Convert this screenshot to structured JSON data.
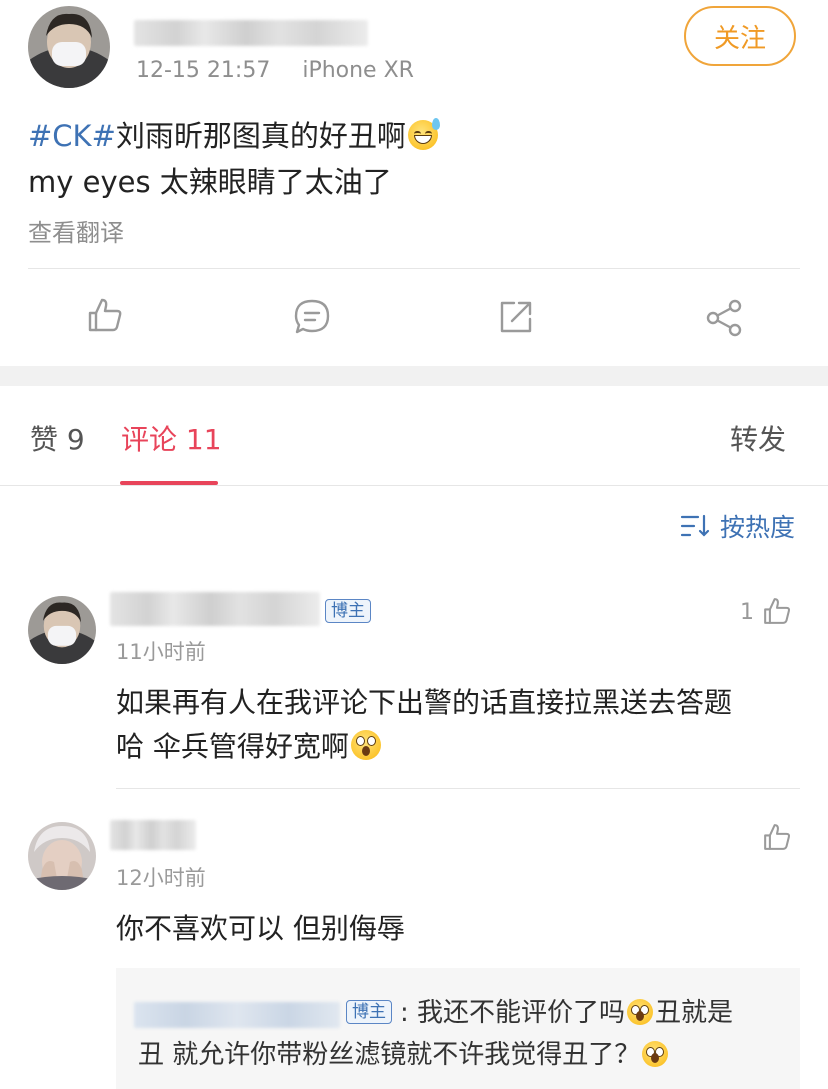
{
  "post": {
    "timestamp": "12-15 21:57",
    "device": "iPhone XR",
    "follow_label": "关注",
    "topic_tag": "#CK#",
    "line1_text": "刘雨昕那图真的好丑啊",
    "line2_text": "my eyes 太辣眼睛了太油了",
    "translate_label": "查看翻译"
  },
  "tabs": {
    "likes_label": "赞 9",
    "comments_label": "评论 11",
    "reposts_label": "转发"
  },
  "sort": {
    "label": "按热度"
  },
  "comments": [
    {
      "badge": "博主",
      "time": "11小时前",
      "like_count": "1",
      "text_line1": "如果再有人在我评论下出警的话直接拉黑送去答题",
      "text_line2": "哈 伞兵管得好宽啊"
    },
    {
      "time": "12小时前",
      "text": "你不喜欢可以 但别侮辱",
      "reply": {
        "badge": "博主",
        "line1_text": ": 我还不能评价了吗",
        "line1_tail": "丑就是",
        "line2_text": "丑 就允许你带粉丝滤镜就不许我觉得丑了？"
      }
    }
  ],
  "colors": {
    "accent_red": "#e8445a",
    "link_blue": "#3e72b4",
    "follow_orange": "#f09a25"
  },
  "icons": [
    "like-icon",
    "comment-icon",
    "repost-icon",
    "share-icon",
    "sort-icon"
  ]
}
